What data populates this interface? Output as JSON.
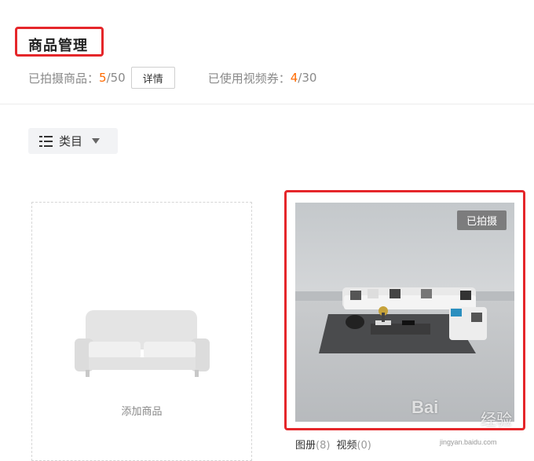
{
  "header": {
    "title": "商品管理",
    "shot_label": "已拍摄商品：",
    "shot_count": "5",
    "shot_total": "/50",
    "detail_button": "详情",
    "coupon_label": "已使用视频券：",
    "coupon_count": "4",
    "coupon_total": "/30"
  },
  "filter": {
    "category_label": "类目",
    "icon": "list-icon"
  },
  "add_card": {
    "label": "添加商品",
    "icon": "sofa-icon"
  },
  "product_card": {
    "badge": "已拍摄",
    "album_label": "图册",
    "album_count": "(8)",
    "video_label": "视频",
    "video_count": "(0)"
  },
  "watermark": {
    "brand": "Bai",
    "brand_suffix": "经验",
    "url": "jingyan.baidu.com"
  },
  "colors": {
    "highlight": "#e5262a",
    "accent": "#ff6a00",
    "muted": "#8a8a8a"
  }
}
